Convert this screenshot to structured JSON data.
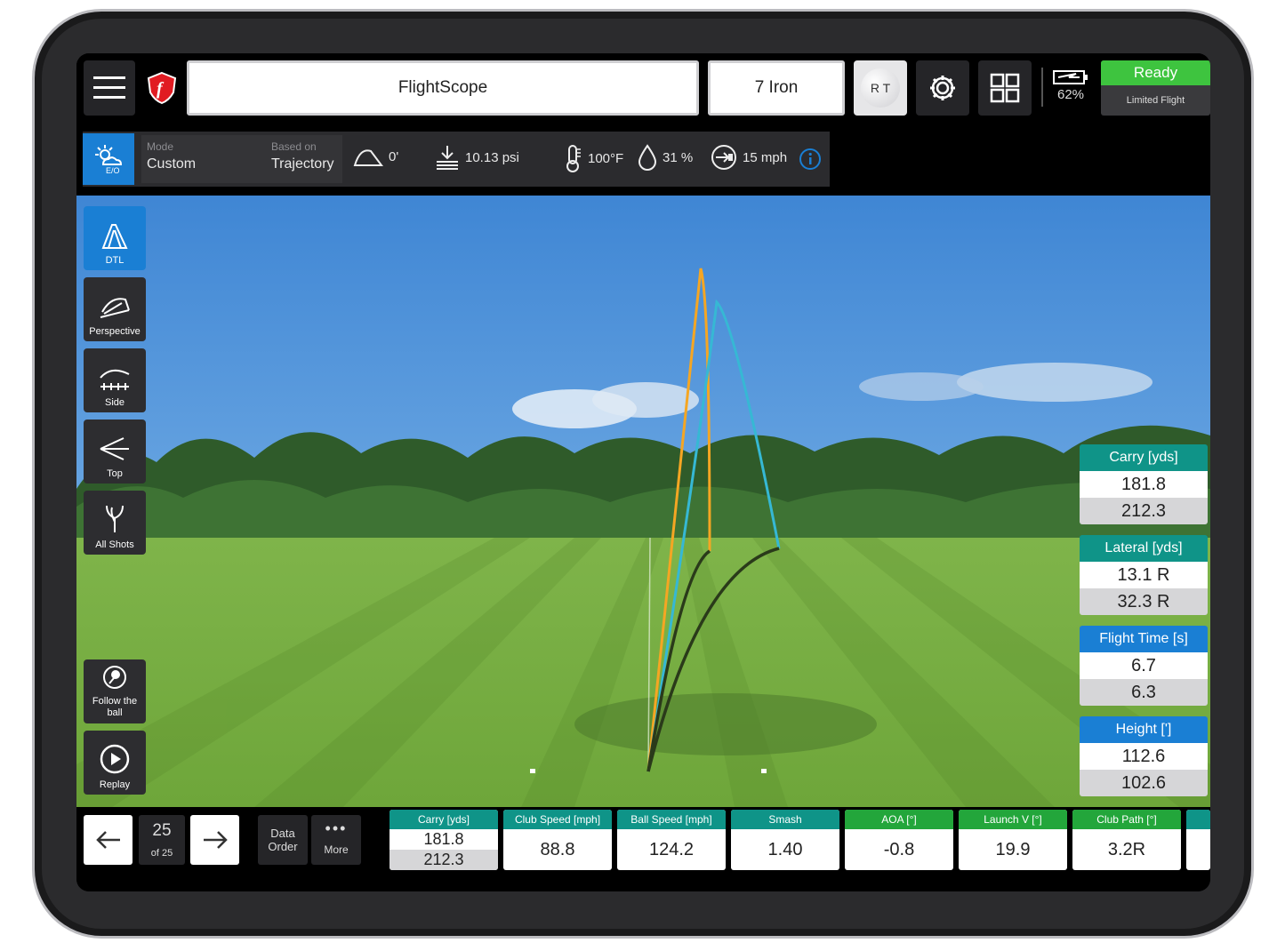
{
  "topbar": {
    "title": "FlightScope",
    "club": "7 Iron",
    "ball_icon_label": "R T",
    "battery": "62%",
    "status": "Ready",
    "status_sub": "Limited Flight"
  },
  "conditions": {
    "eo_label": "E/O",
    "mode_label": "Mode",
    "mode_value": "Custom",
    "based_label": "Based on",
    "based_value": "Trajectory",
    "slope": "0'",
    "pressure": "10.13 psi",
    "temperature": "100°F",
    "humidity": "31 %",
    "wind": "15 mph"
  },
  "views": [
    {
      "label": "DTL"
    },
    {
      "label": "Perspective"
    },
    {
      "label": "Side"
    },
    {
      "label": "Top"
    },
    {
      "label": "All Shots"
    }
  ],
  "follow_label": "Follow the ball",
  "replay_label": "Replay",
  "side_panels": [
    {
      "label": "Carry [yds]",
      "v1": "181.8",
      "v2": "212.3",
      "color": "#0f9488"
    },
    {
      "label": "Lateral [yds]",
      "v1": "13.1 R",
      "v2": "32.3 R",
      "color": "#0f9488"
    },
    {
      "label": "Flight Time [s]",
      "v1": "6.7",
      "v2": "6.3",
      "color": "#1a7fd4"
    },
    {
      "label": "Height [']",
      "v1": "112.6",
      "v2": "102.6",
      "color": "#1a7fd4"
    }
  ],
  "bottom": {
    "shot_number": "25",
    "shot_total": "of 25",
    "data_order": "Data Order",
    "more": "More",
    "tiles": [
      {
        "label": "Carry [yds]",
        "v1": "181.8",
        "v2": "212.3",
        "color": "#0f9488"
      },
      {
        "label": "Club Speed [mph]",
        "value": "88.8",
        "color": "#0f9488"
      },
      {
        "label": "Ball Speed [mph]",
        "value": "124.2",
        "color": "#0f9488"
      },
      {
        "label": "Smash",
        "value": "1.40",
        "color": "#0f9488"
      },
      {
        "label": "AOA [°]",
        "value": "-0.8",
        "color": "#23a63b"
      },
      {
        "label": "Launch V [°]",
        "value": "19.9",
        "color": "#23a63b"
      },
      {
        "label": "Club Path [°]",
        "value": "3.2R",
        "color": "#23a63b"
      }
    ]
  },
  "colors": {
    "accent_blue": "#1a7fd4",
    "teal": "#0f9488",
    "green": "#23a63b",
    "trace_orange": "#f5a623",
    "trace_cyan": "#36b8d4"
  }
}
